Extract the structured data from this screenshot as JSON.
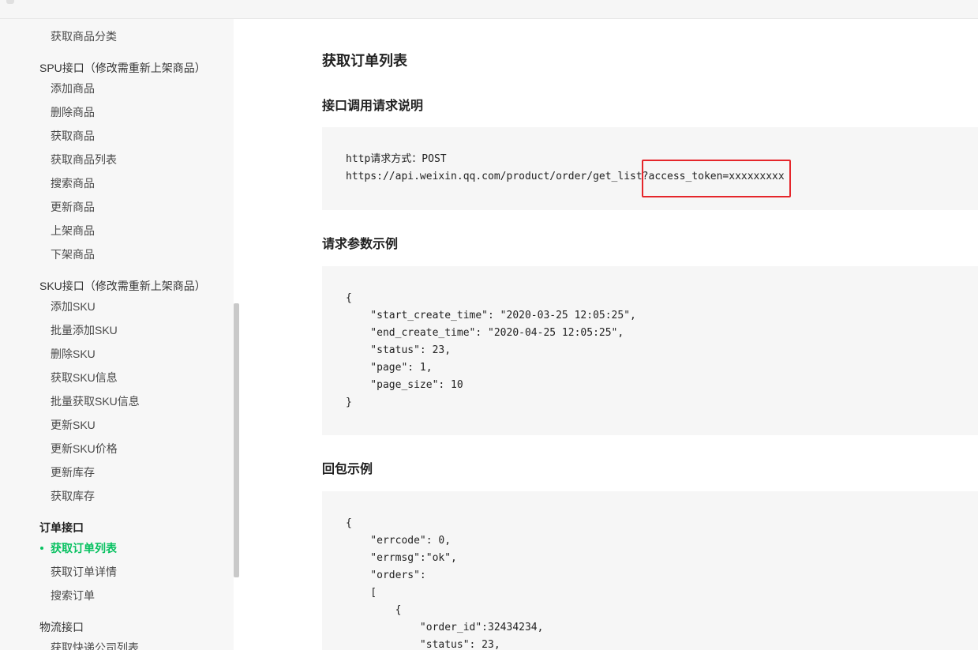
{
  "sidebar": {
    "items": [
      {
        "label": "获取商品分类",
        "kind": "item"
      },
      {
        "label": "SPU接口（修改需重新上架商品）",
        "kind": "group"
      },
      {
        "label": "添加商品",
        "kind": "item"
      },
      {
        "label": "删除商品",
        "kind": "item"
      },
      {
        "label": "获取商品",
        "kind": "item"
      },
      {
        "label": "获取商品列表",
        "kind": "item"
      },
      {
        "label": "搜索商品",
        "kind": "item"
      },
      {
        "label": "更新商品",
        "kind": "item"
      },
      {
        "label": "上架商品",
        "kind": "item"
      },
      {
        "label": "下架商品",
        "kind": "item"
      },
      {
        "label": "SKU接口（修改需重新上架商品）",
        "kind": "group"
      },
      {
        "label": "添加SKU",
        "kind": "item"
      },
      {
        "label": "批量添加SKU",
        "kind": "item"
      },
      {
        "label": "删除SKU",
        "kind": "item"
      },
      {
        "label": "获取SKU信息",
        "kind": "item"
      },
      {
        "label": "批量获取SKU信息",
        "kind": "item"
      },
      {
        "label": "更新SKU",
        "kind": "item"
      },
      {
        "label": "更新SKU价格",
        "kind": "item"
      },
      {
        "label": "更新库存",
        "kind": "item"
      },
      {
        "label": "获取库存",
        "kind": "item"
      },
      {
        "label": "订单接口",
        "kind": "group-bold"
      },
      {
        "label": "获取订单列表",
        "kind": "item-active"
      },
      {
        "label": "获取订单详情",
        "kind": "item"
      },
      {
        "label": "搜索订单",
        "kind": "item"
      },
      {
        "label": "物流接口",
        "kind": "group"
      },
      {
        "label": "获取快递公司列表",
        "kind": "item"
      }
    ],
    "active_color": "#07c160"
  },
  "main": {
    "title": "获取订单列表",
    "request_section": {
      "heading": "接口调用请求说明",
      "lines": [
        "http请求方式：POST",
        "https://api.weixin.qq.com/product/order/get_list?access_token=xxxxxxxxx"
      ]
    },
    "params_section": {
      "heading": "请求参数示例",
      "lines": [
        "{",
        "    \"start_create_time\": \"2020-03-25 12:05:25\",",
        "    \"end_create_time\": \"2020-04-25 12:05:25\",",
        "    \"status\": 23,",
        "    \"page\": 1,",
        "    \"page_size\": 10",
        "}"
      ]
    },
    "response_section": {
      "heading": "回包示例",
      "lines": [
        "{",
        "    \"errcode\": 0,",
        "    \"errmsg\":\"ok\",",
        "    \"orders\":",
        "    [",
        "        {",
        "            \"order_id\":32434234,",
        "            \"status\": 23,"
      ]
    },
    "highlight_color": "#e5262b"
  }
}
